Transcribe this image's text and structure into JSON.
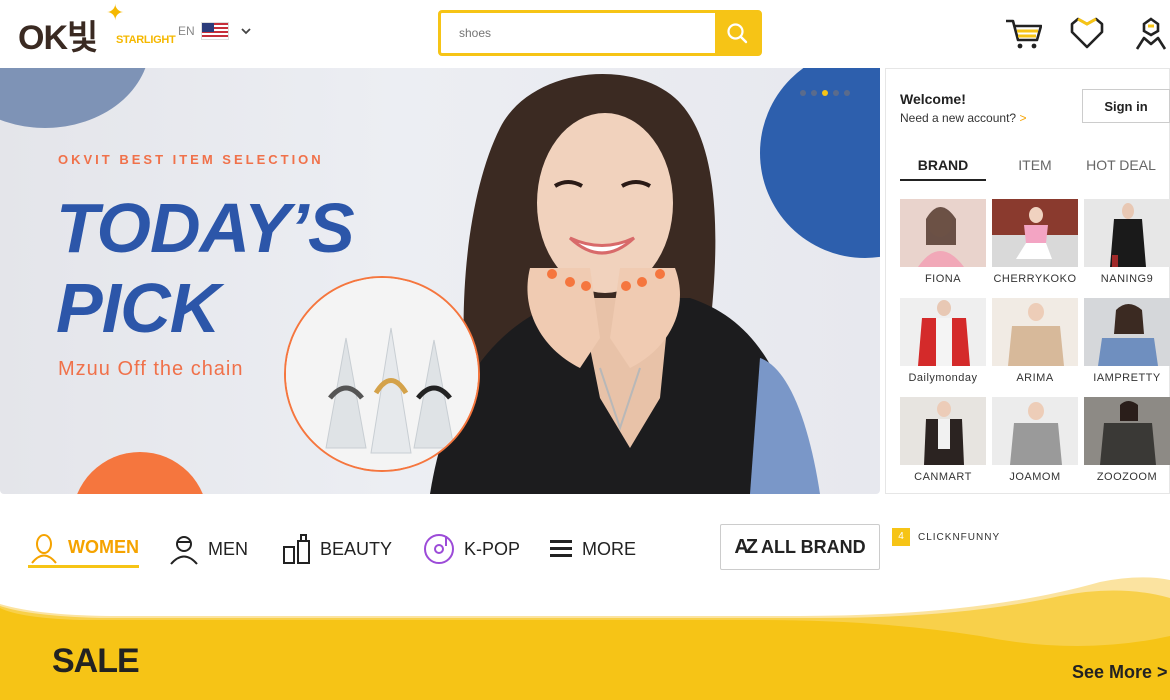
{
  "header": {
    "logo_text": "OK빛",
    "logo_sub": "STARLIGHT",
    "lang_code": "EN",
    "search_placeholder": "shoes",
    "accent_color": "#f6c416",
    "icons": [
      "cart-icon",
      "heart-icon",
      "user-icon"
    ]
  },
  "banner": {
    "kicker": "OKVIT BEST ITEM SELECTION",
    "title_line1": "TODAY’S",
    "title_line2": "PICK",
    "subtitle": "Mzuu Off the chain",
    "slide_count": 5,
    "active_slide": 3
  },
  "side_panel": {
    "welcome": "Welcome!",
    "need_account": "Need a new account?",
    "arrow": ">",
    "signin_label": "Sign in",
    "tabs": [
      {
        "label": "BRAND",
        "active": true
      },
      {
        "label": "ITEM",
        "active": false
      },
      {
        "label": "HOT DEAL",
        "active": false
      }
    ],
    "brands": [
      {
        "name": "FIONA"
      },
      {
        "name": "CHERRYKOKO"
      },
      {
        "name": "NANING9"
      },
      {
        "name": "Dailymonday"
      },
      {
        "name": "ARIMA"
      },
      {
        "name": "IAMPRETTY"
      },
      {
        "name": "CANMART"
      },
      {
        "name": "JOAMOM"
      },
      {
        "name": "ZOOZOOM"
      }
    ]
  },
  "categories": [
    {
      "label": "WOMEN",
      "icon": "woman-icon",
      "active": true
    },
    {
      "label": "MEN",
      "icon": "man-icon",
      "active": false
    },
    {
      "label": "BEAUTY",
      "icon": "cosmetics-icon",
      "active": false
    },
    {
      "label": "K-POP",
      "icon": "music-disc-icon",
      "active": false
    },
    {
      "label": "MORE",
      "icon": "menu-icon",
      "active": false
    }
  ],
  "all_brand": {
    "label": "ALL BRAND",
    "icon_text": "AZ"
  },
  "ranking": {
    "number": "4",
    "name": "CLICKNFUNNY"
  },
  "sale": {
    "title": "SALE",
    "see_more": "See More >"
  }
}
